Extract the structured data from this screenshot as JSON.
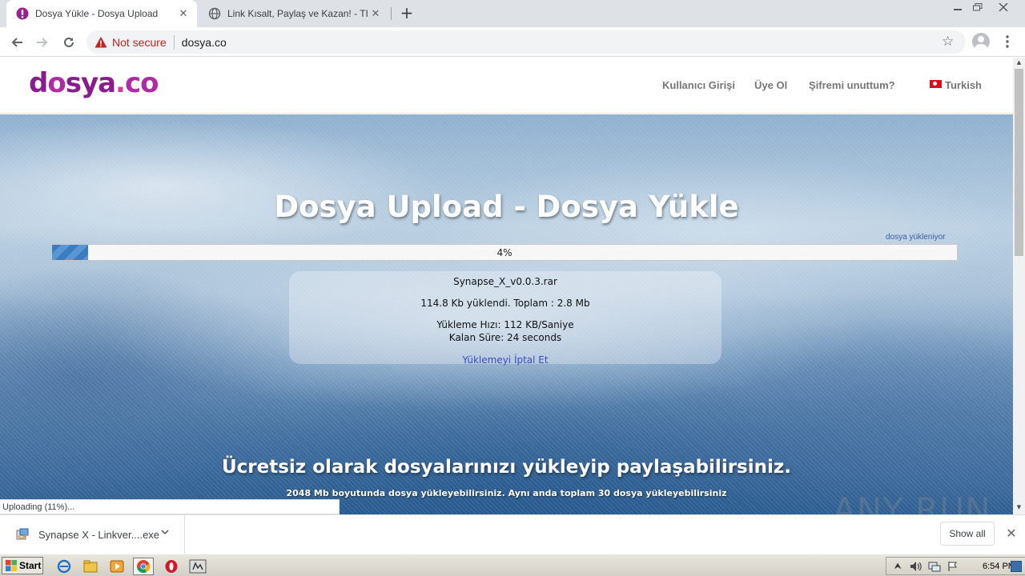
{
  "browser": {
    "tabs": [
      {
        "title": "Dosya Yükle - Dosya Upload",
        "active": true,
        "favicon": "dosya-favicon"
      },
      {
        "title": "Link Kısalt, Paylaş ve Kazan! - TIK.LA",
        "active": false,
        "favicon": "globe-icon"
      }
    ],
    "security_label": "Not secure",
    "url": "dosya.co"
  },
  "site": {
    "logo_text": "dosya.co",
    "nav": {
      "login": "Kullanıcı Girişi",
      "register": "Üye Ol",
      "forgot": "Şifremi unuttum?",
      "language": "Turkish"
    },
    "hero_title": "Dosya Upload - Dosya Yükle",
    "upload_status_label": "dosya yükleniyor",
    "progress": {
      "percent_label": "4%",
      "fraction": 0.04
    },
    "file": {
      "name": "Synapse_X_v0.0.3.rar",
      "uploaded_line": "114.8 Kb yüklendi. Toplam : 2.8 Mb",
      "speed_line": "Yükleme Hızı: 112 KB/Saniye",
      "remaining_line": "Kalan Süre: 24 seconds",
      "cancel_label": "Yüklemeyi İptal Et"
    },
    "tagline": "Ücretsiz olarak dosyalarınızı yükleyip paylaşabilirsiniz.",
    "subline": "2048 Mb boyutunda dosya yükleyebilirsiniz. Aynı anda toplam 30 dosya yükleyebilirsiniz"
  },
  "status_bubble": "Uploading (11%)...",
  "watermark": "ANY RUN",
  "downloads": {
    "item_name": "Synapse X - Linkver....exe",
    "show_all": "Show all"
  },
  "taskbar": {
    "start_label": "Start",
    "clock": "6:54 PM"
  },
  "colors": {
    "not_secure": "#c5221f",
    "logo_purple": "#8a1d8d",
    "progress_blue": "#3b7bbf",
    "cancel_link": "#3a4dc0"
  }
}
